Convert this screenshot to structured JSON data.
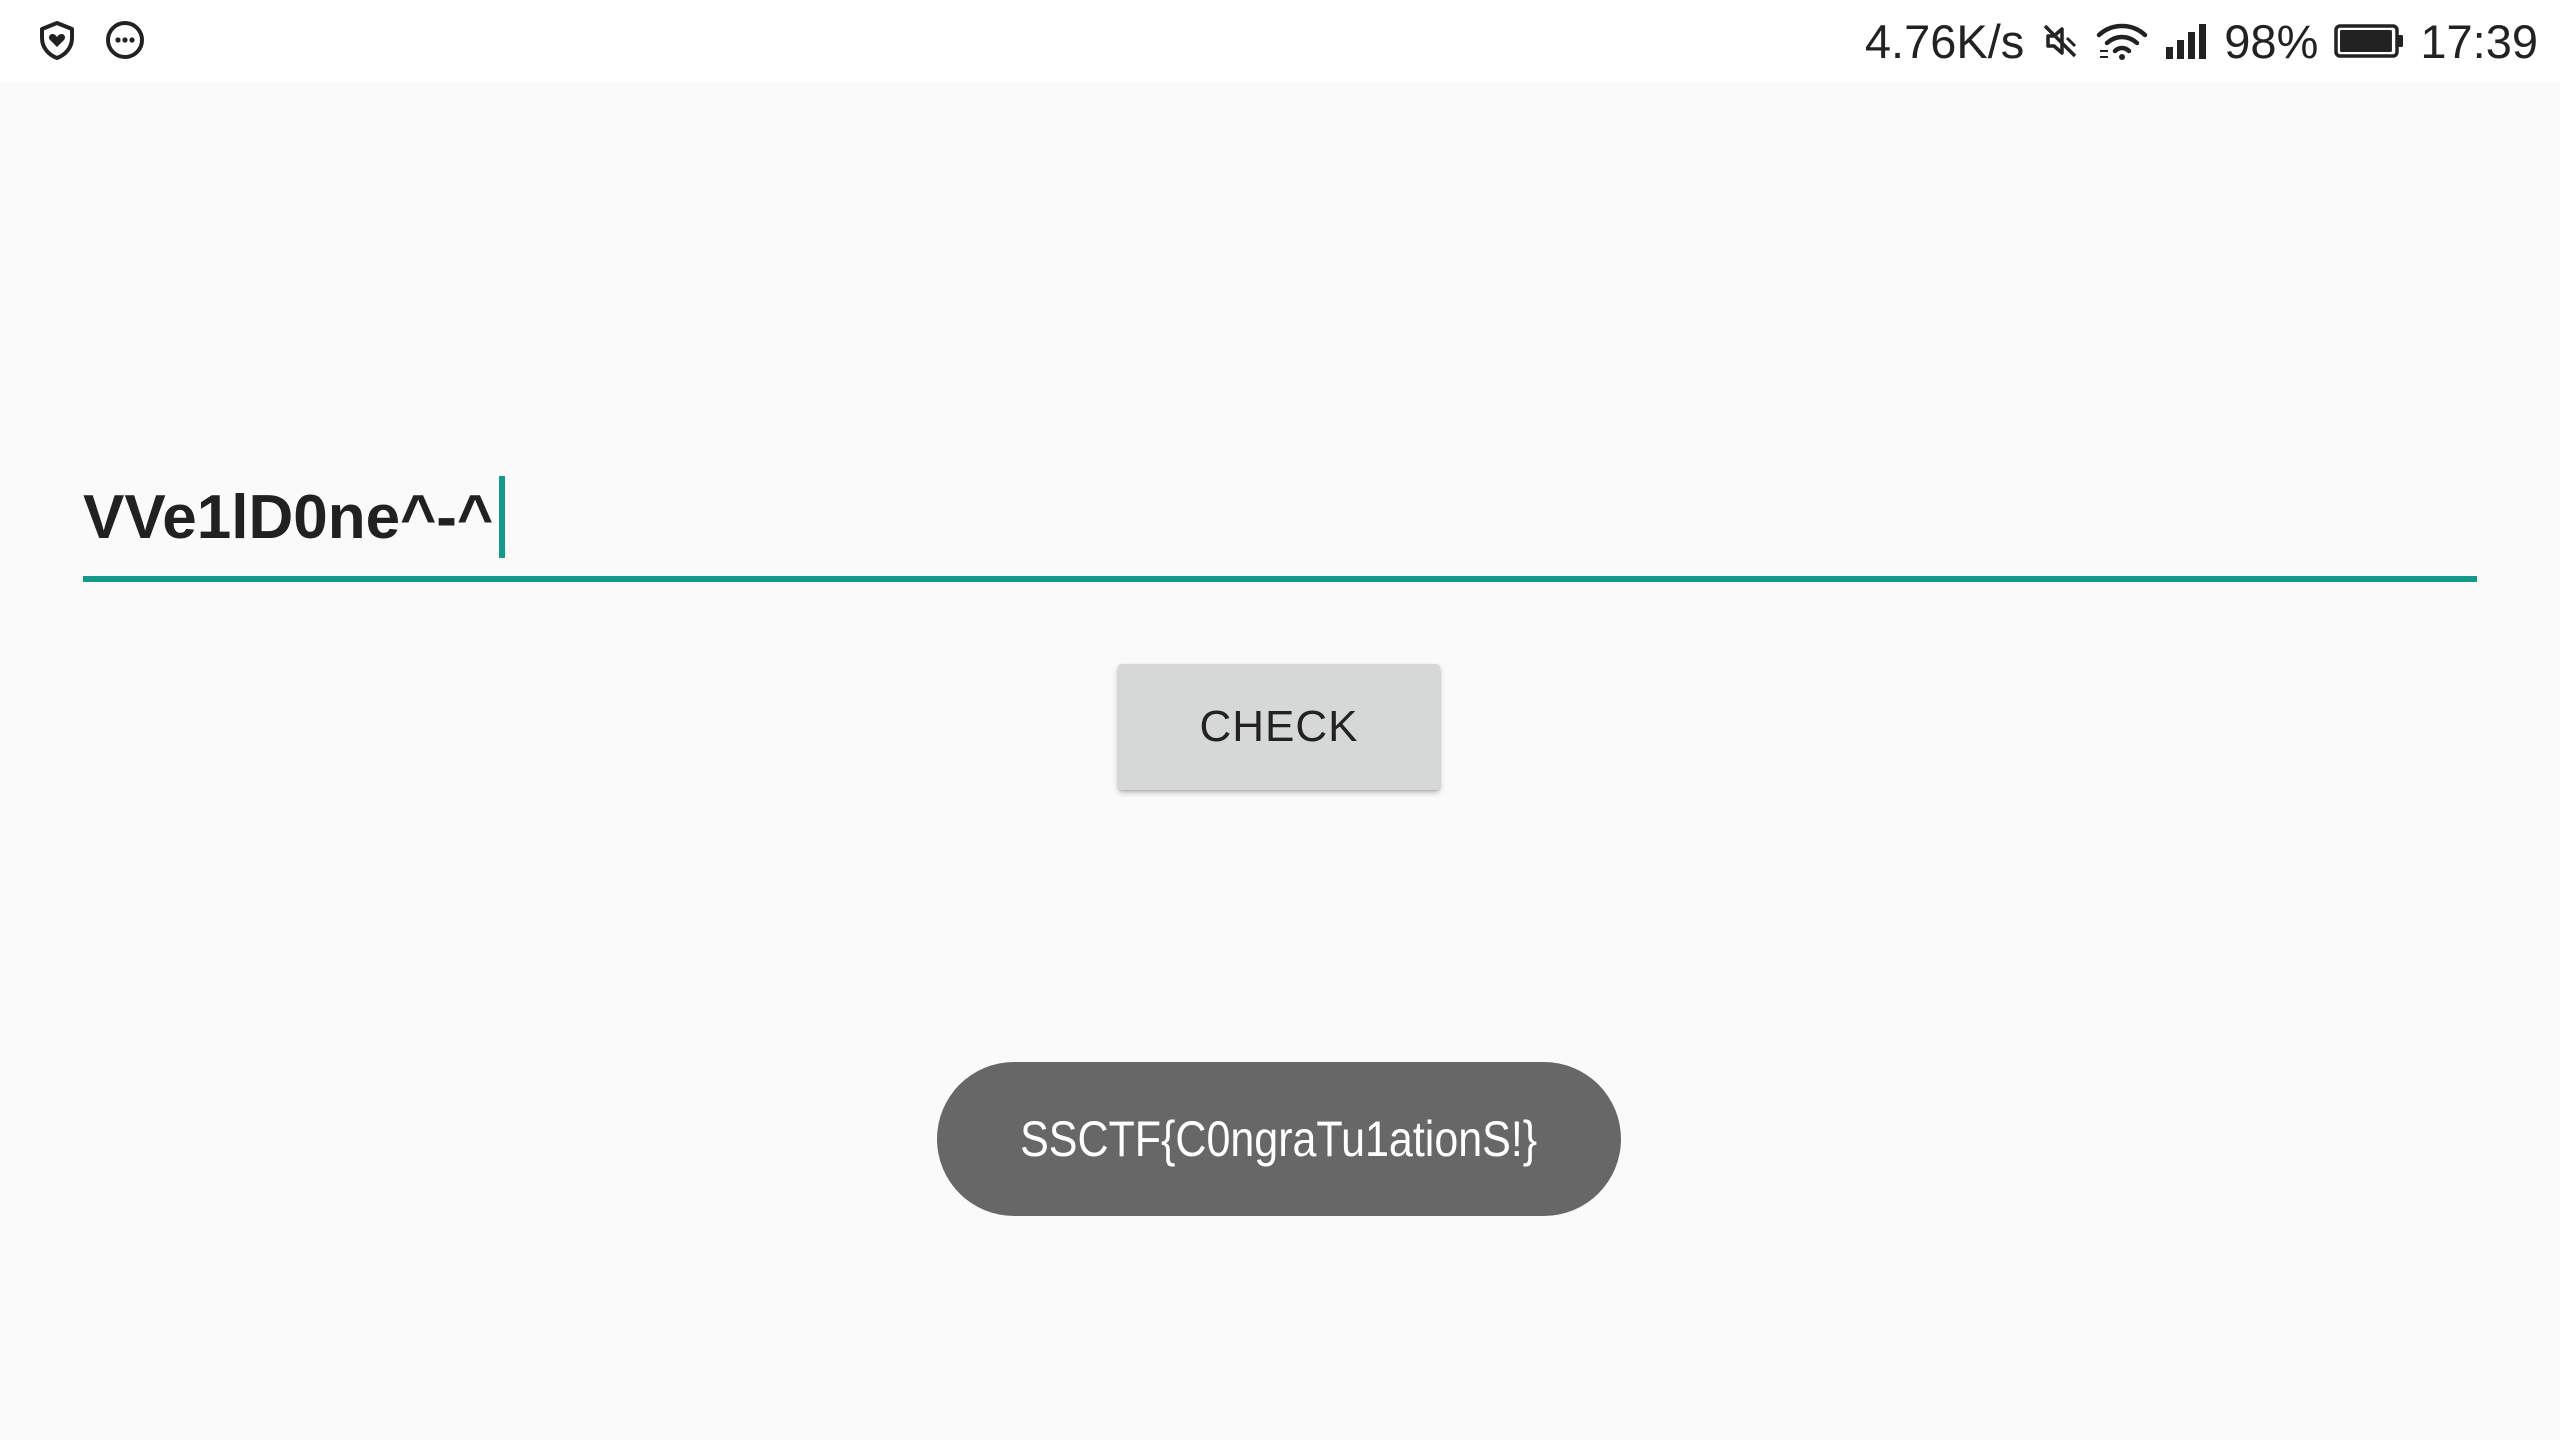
{
  "status_bar": {
    "left_icons": [
      "shield-heart-icon",
      "chat-bubble-icon"
    ],
    "network_speed": "4.76K/s",
    "icons": [
      "mute-icon",
      "wifi-icon",
      "signal-icon"
    ],
    "battery_percent": "98%",
    "battery_level": 0.98,
    "time": "17:39"
  },
  "form": {
    "input_value": "VVe1lD0ne^-^",
    "check_label": "CHECK"
  },
  "toast": {
    "message": "SSCTF{C0ngraTu1ationS!}"
  },
  "colors": {
    "accent": "#139a8a",
    "background": "#fafafa",
    "button": "#d6d7d7",
    "toast": "#676767"
  }
}
